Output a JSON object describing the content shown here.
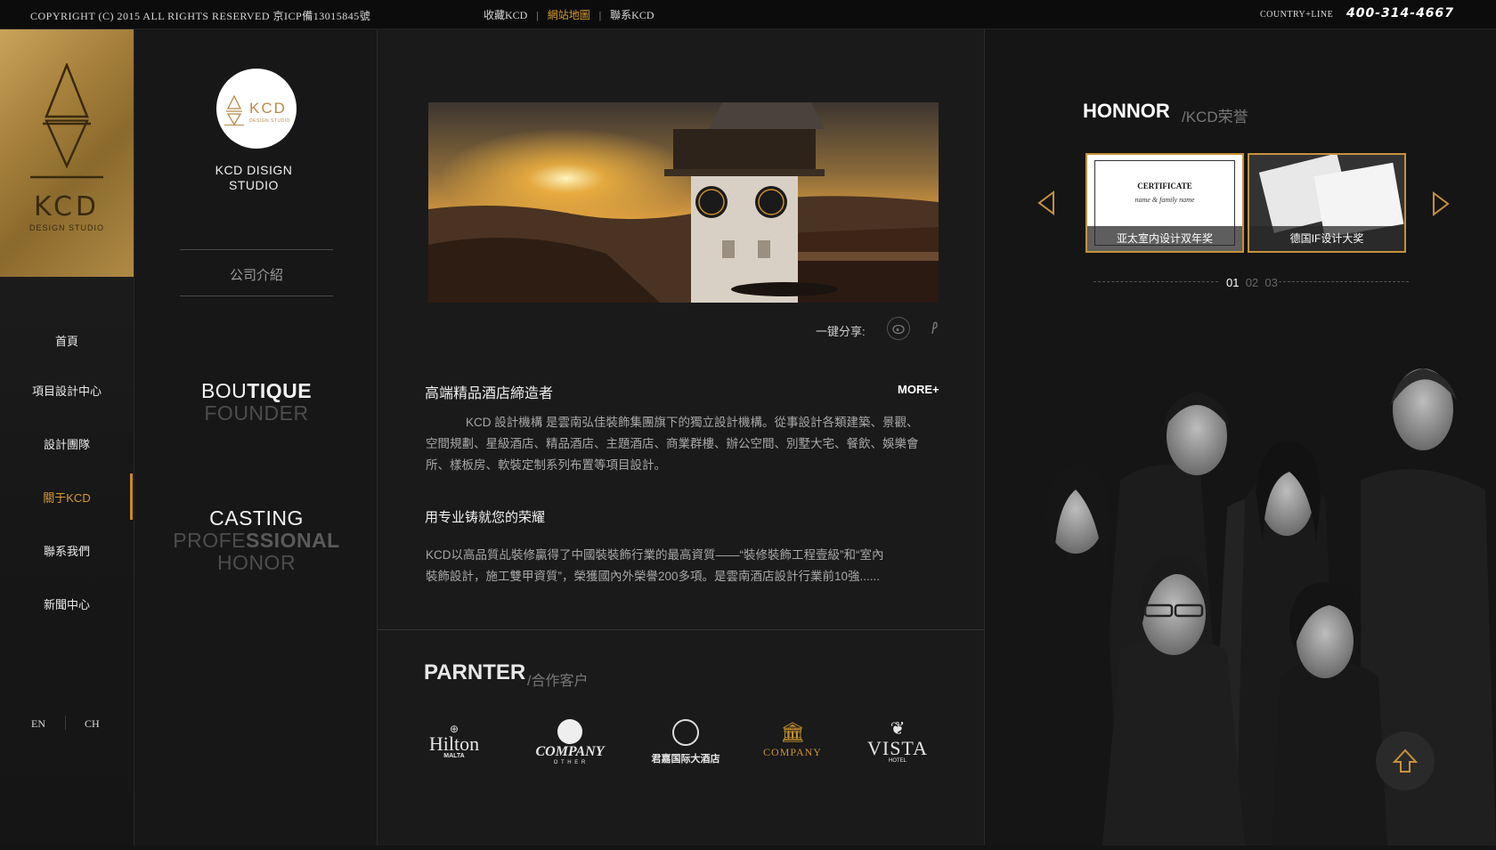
{
  "topbar": {
    "copyright": "COPYRIGHT (C) 2015  ALL  RIGHTS RESERVED    京ICP備13015845號",
    "links": [
      "收藏KCD",
      "網站地圖",
      "聯系KCD"
    ],
    "country": "COUNTRY+LINE",
    "phone": "400-314-4667"
  },
  "brand": {
    "logo_text": "KCD",
    "logo_sub": "DESIGN STUDIO",
    "studio_name_1": "KCD DISIGN",
    "studio_name_2": "STUDIO"
  },
  "nav": {
    "items": [
      "首頁",
      "項目設計中心",
      "設計團隊",
      "關于KCD",
      "聯系我們",
      "新聞中心"
    ],
    "active_index": 3
  },
  "lang": {
    "en": "EN",
    "ch": "CH"
  },
  "about": {
    "label": "公司介紹",
    "slogan1": {
      "light": "BOU",
      "bold": "TIQUE",
      "line2": "FOUNDER"
    },
    "slogan2": {
      "line1": "CASTING",
      "line2_a": "PROFE",
      "line2_b": "SSIONAL",
      "line3": "HONOR"
    }
  },
  "article": {
    "share_label": "一键分享:",
    "title": "高端精品酒店締造者",
    "more": "MORE+",
    "para1_l1": "KCD 設計機構 是雲南弘佳裝飾集團旗下的獨立設計機構。從事設計各類建築、景觀、",
    "para1_l2": "空間規劃、星級酒店、精品酒店、主題酒店、商業群樓、辦公空間、別墅大宅、餐飲、娛樂會",
    "para1_l3": "所、樣板房、軟裝定制系列布置等項目設計。",
    "subtitle": "用专业铸就您的荣耀",
    "para2_l1": "KCD以高品質乩裝修贏得了中國裝裝飾行業的最高資質——“裝修裝飾工程壹級”和“室內",
    "para2_l2": "裝飾設計，施工雙甲資質”，榮獲國內外榮譽200多項。是雲南酒店設計行業前10強......"
  },
  "partners": {
    "title": "PARNTER",
    "subtitle": "/合作客户",
    "logos": [
      {
        "name": "Hilton",
        "sub": "MALTA"
      },
      {
        "name": "COMPANY",
        "sub": "O T H E R"
      },
      {
        "name": "君嘉国际大酒店",
        "sub": ""
      },
      {
        "name": "COMPANY",
        "sub": ""
      },
      {
        "name": "VISTA",
        "sub": "HOTEL"
      }
    ]
  },
  "honor": {
    "title": "HONNOR",
    "subtitle": "/KCD荣誉",
    "cert_heading": "CERTIFICATE",
    "cert_line": "name & family name",
    "items": [
      "亚太室内设计双年奖",
      "德国IF设计大奖"
    ],
    "pages": [
      "01",
      "02",
      "03"
    ],
    "current_page": 0
  },
  "colors": {
    "accent": "#d49a2f",
    "gold": "#b08a45",
    "bg": "#141414"
  },
  "icons": [
    "weibo-icon",
    "pinterest-icon",
    "arrow-left-icon",
    "arrow-right-icon",
    "back-to-top-icon"
  ]
}
